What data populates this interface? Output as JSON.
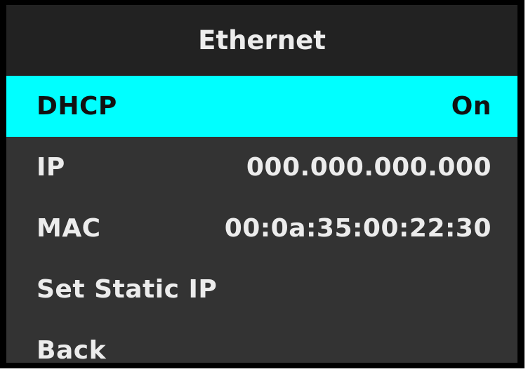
{
  "colors": {
    "frame": "#000000",
    "header_bg": "#222222",
    "menu_bg": "#333333",
    "highlight": "#00ffff",
    "text": "#ececec",
    "highlight_text": "#111111"
  },
  "header": {
    "title": "Ethernet"
  },
  "menu": {
    "items": [
      {
        "label": "DHCP",
        "value": "On",
        "selected": true
      },
      {
        "label": "IP",
        "value": "000.000.000.000",
        "selected": false
      },
      {
        "label": "MAC",
        "value": "00:0a:35:00:22:30",
        "selected": false
      },
      {
        "label": "Set Static IP",
        "value": "",
        "selected": false
      },
      {
        "label": "Back",
        "value": "",
        "selected": false
      }
    ]
  }
}
